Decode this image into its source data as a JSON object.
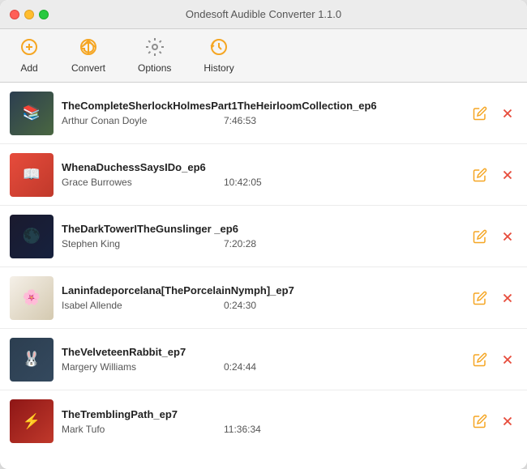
{
  "window": {
    "title": "Ondesoft Audible Converter 1.1.0"
  },
  "toolbar": {
    "buttons": [
      {
        "id": "add",
        "label": "Add",
        "icon": "add"
      },
      {
        "id": "convert",
        "label": "Convert",
        "icon": "convert"
      },
      {
        "id": "options",
        "label": "Options",
        "icon": "options"
      },
      {
        "id": "history",
        "label": "History",
        "icon": "history"
      }
    ]
  },
  "books": [
    {
      "title": "TheCompleteSherlockHolmesPart1TheHeirloomCollection_ep6",
      "author": "Arthur Conan Doyle",
      "duration": "7:46:53",
      "coverClass": "book-cover-1",
      "coverEmoji": "📚"
    },
    {
      "title": "WhenaDuchessSaysIDo_ep6",
      "author": "Grace Burrowes",
      "duration": "10:42:05",
      "coverClass": "book-cover-2",
      "coverEmoji": "📖"
    },
    {
      "title": "TheDarkTowerITheGunslinger _ep6",
      "author": "Stephen King",
      "duration": "7:20:28",
      "coverClass": "book-cover-3",
      "coverEmoji": "🌑"
    },
    {
      "title": "Laninfadeporcelana[ThePorcelainNymph]_ep7",
      "author": "Isabel Allende",
      "duration": "0:24:30",
      "coverClass": "book-cover-4",
      "coverEmoji": "🌸"
    },
    {
      "title": "TheVelveteenRabbit_ep7",
      "author": "Margery Williams",
      "duration": "0:24:44",
      "coverClass": "book-cover-5",
      "coverEmoji": "🐰"
    },
    {
      "title": "TheTremblingPath_ep7",
      "author": "Mark Tufo",
      "duration": "11:36:34",
      "coverClass": "book-cover-6",
      "coverEmoji": "⚡"
    }
  ]
}
